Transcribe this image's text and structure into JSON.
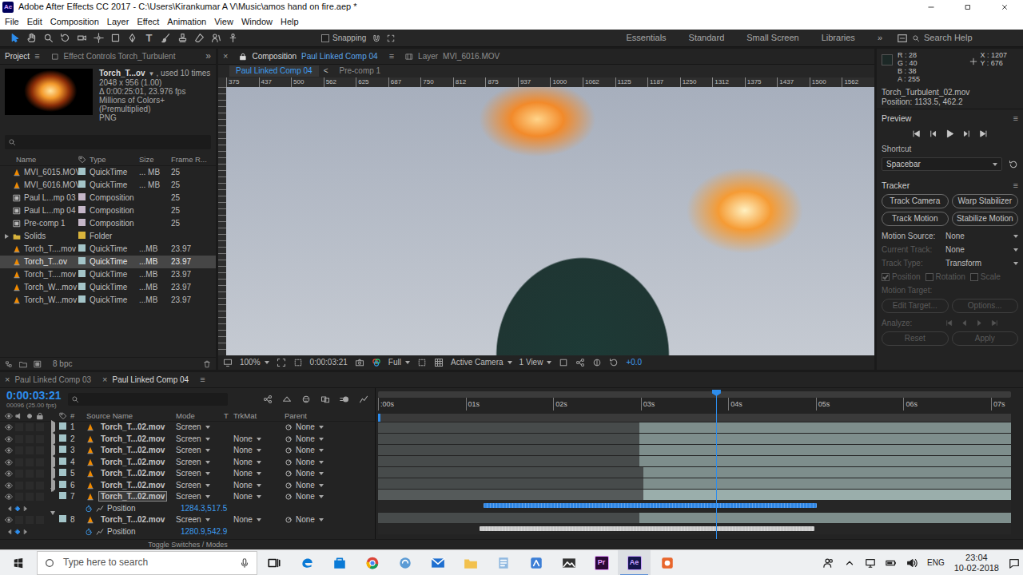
{
  "window": {
    "app_icon": "Ae",
    "title": "Adobe After Effects CC 2017 - C:\\Users\\Kirankumar A V\\Music\\amos hand on fire.aep *"
  },
  "menu": [
    "File",
    "Edit",
    "Composition",
    "Layer",
    "Effect",
    "Animation",
    "View",
    "Window",
    "Help"
  ],
  "toolbar": {
    "tools": [
      {
        "kind": "select",
        "selected": true
      },
      {
        "kind": "hand",
        "selected": false
      },
      {
        "kind": "zoom",
        "selected": false
      },
      {
        "kind": "rotate",
        "selected": false
      },
      {
        "kind": "camera",
        "selected": false
      },
      {
        "kind": "pan-behind",
        "selected": false
      },
      {
        "kind": "rectangle",
        "selected": false
      },
      {
        "kind": "pen",
        "selected": false
      },
      {
        "kind": "type",
        "label": "T",
        "selected": false
      },
      {
        "kind": "brush",
        "selected": false
      },
      {
        "kind": "stamp",
        "selected": false
      },
      {
        "kind": "eraser",
        "selected": false
      },
      {
        "kind": "roto",
        "selected": false
      },
      {
        "kind": "puppet",
        "selected": false
      }
    ],
    "snapping": {
      "label": "Snapping",
      "checked": false
    },
    "workspaces": [
      {
        "label": "Essentials",
        "selected": false
      },
      {
        "label": "Standard",
        "selected": false
      },
      {
        "label": "Small Screen",
        "selected": false
      },
      {
        "label": "Libraries",
        "selected": false
      }
    ],
    "more": "»",
    "search": "Search Help"
  },
  "project": {
    "tabs": [
      {
        "label": "Project",
        "selected": true
      },
      {
        "label": "Effect Controls Torch_Turbulent",
        "selected": false
      }
    ],
    "menu": "≡",
    "more": "»",
    "info": {
      "name": "Torch_T...ov",
      "dropdown": "▼",
      "used": ", used 10 times",
      "size": "2048 x 956 (1.00)",
      "duration": "Δ 0:00:25:01, 23.976 fps",
      "colors": "Millions of Colors+ (Premultiplied)",
      "format": "PNG"
    },
    "columns": [
      "Name",
      "Type",
      "Size",
      "Frame R..."
    ],
    "items": [
      {
        "name": "MVI_6015.MOV",
        "kind": "footage",
        "type": "QuickTime",
        "size": "... MB",
        "fps": "25",
        "color": "#a3c4c8",
        "selected": false
      },
      {
        "name": "MVI_6016.MOV",
        "kind": "footage",
        "type": "QuickTime",
        "size": "... MB",
        "fps": "25",
        "color": "#a3c4c8",
        "selected": false
      },
      {
        "name": "Paul L...mp 03",
        "kind": "composition",
        "type": "Composition",
        "fps": "25",
        "color": "#c4b6c8",
        "selected": false
      },
      {
        "name": "Paul L...mp 04",
        "kind": "composition",
        "type": "Composition",
        "fps": "25",
        "color": "#c4b6c8",
        "selected": false
      },
      {
        "name": "Pre-comp 1",
        "kind": "composition",
        "type": "Composition",
        "fps": "25",
        "color": "#c4b6c8",
        "selected": false
      },
      {
        "name": "Solids",
        "kind": "folder",
        "type": "Folder",
        "color": "#d8b33c",
        "expanded": false,
        "selected": false
      },
      {
        "name": "Torch_T....mov",
        "kind": "footage",
        "type": "QuickTime",
        "size": "...MB",
        "fps": "23.97",
        "color": "#a3c4c8",
        "selected": false
      },
      {
        "name": "Torch_T...ov",
        "kind": "footage",
        "type": "QuickTime",
        "size": "...MB",
        "fps": "23.97",
        "color": "#a3c4c8",
        "selected": true
      },
      {
        "name": "Torch_T....mov",
        "kind": "footage",
        "type": "QuickTime",
        "size": "...MB",
        "fps": "23.97",
        "color": "#a3c4c8",
        "selected": false
      },
      {
        "name": "Torch_W...mov",
        "kind": "footage",
        "type": "QuickTime",
        "size": "...MB",
        "fps": "23.97",
        "color": "#a3c4c8",
        "selected": false
      },
      {
        "name": "Torch_W...mov",
        "kind": "footage",
        "type": "QuickTime",
        "size": "...MB",
        "fps": "23.97",
        "color": "#a3c4c8",
        "selected": false
      }
    ],
    "bpc": "8 bpc"
  },
  "viewer": {
    "close": "×",
    "tabs": [
      {
        "prefix": "Composition",
        "label": "Paul Linked Comp 04",
        "kind": "composition",
        "selected": true
      },
      {
        "prefix": "Layer",
        "label": "MVI_6016.MOV",
        "kind": "layer",
        "selected": false
      }
    ],
    "menu": "≡",
    "crumbs": [
      {
        "label": "Paul Linked Comp 04",
        "selected": true
      },
      {
        "label": "Pre-comp 1",
        "selected": false
      }
    ],
    "crumb_sep": "<",
    "ruler": [
      "375",
      "437",
      "500",
      "562",
      "625",
      "687",
      "750",
      "812",
      "875",
      "937",
      "1000",
      "1062",
      "1125",
      "1187",
      "1250",
      "1312",
      "1375",
      "1437",
      "1500",
      "1562"
    ],
    "footer": {
      "zoom": "100%",
      "time": "0:00:03:21",
      "resolution": "Full",
      "camera": "Active Camera",
      "views": "1 View",
      "exposure": "+0.0"
    }
  },
  "side": {
    "info": {
      "swatch": "#1c2826",
      "lines": [
        "R : 28",
        "G : 40",
        "B : 38",
        "A : 255"
      ],
      "coords": [
        "X : 1207",
        "Y : 676"
      ],
      "layer": "Torch_Turbulent_02.mov",
      "position": "Position: 1133.5, 462.2"
    },
    "preview": {
      "title": "Preview",
      "menu": "≡",
      "controls": [
        "first",
        "prev",
        "play",
        "next",
        "last"
      ],
      "shortcut_label": "Shortcut",
      "shortcut": "Spacebar"
    },
    "tracker": {
      "title": "Tracker",
      "menu": "≡",
      "buttons": [
        "Track Camera",
        "Warp Stabilizer",
        "Track Motion",
        "Stabilize Motion"
      ],
      "fields": [
        {
          "label": "Motion Source:",
          "value": "None",
          "disabled": false
        },
        {
          "label": "Current Track:",
          "value": "None",
          "disabled": true
        },
        {
          "label": "Track Type:",
          "value": "Transform",
          "disabled": true
        }
      ],
      "checks": [
        {
          "label": "Position",
          "checked": true,
          "disabled": true
        },
        {
          "label": "Rotation",
          "checked": false,
          "disabled": true
        },
        {
          "label": "Scale",
          "checked": false,
          "disabled": true
        }
      ],
      "target_label": "Motion Target:",
      "target_disabled": true,
      "target_buttons": [
        {
          "label": "Edit Target...",
          "disabled": true
        },
        {
          "label": "Options...",
          "disabled": true
        }
      ],
      "analyze_label": "Analyze:",
      "analyze_disabled": true,
      "actions": [
        {
          "label": "Reset",
          "disabled": true
        },
        {
          "label": "Apply",
          "disabled": true
        }
      ]
    }
  },
  "timeline": {
    "tabs": [
      {
        "close": "×",
        "label": "Paul Linked Comp 03",
        "selected": false
      },
      {
        "close": "×",
        "label": "Paul Linked Comp 04",
        "selected": true
      }
    ],
    "menu": "≡",
    "time": "0:00:03:21",
    "frame": "00096 (25.00 fps)",
    "columns": [
      "#",
      "Source Name",
      "Mode",
      "T",
      "TrkMat",
      "Parent"
    ],
    "ruler": [
      ":00s",
      "01s",
      "02s",
      "03s",
      "04s",
      "05s",
      "06s",
      "07s"
    ],
    "playhead": 0.534,
    "layers": [
      {
        "num": "1",
        "name": "Torch_T...02.mov",
        "mode": "Screen",
        "trkmat": null,
        "parent": "None",
        "visible": true,
        "expanded": false,
        "selected": false,
        "start": 0.413
      },
      {
        "num": "2",
        "name": "Torch_T...02.mov",
        "mode": "Screen",
        "trkmat": "None",
        "parent": "None",
        "visible": true,
        "expanded": false,
        "selected": false,
        "start": 0.413
      },
      {
        "num": "3",
        "name": "Torch_T...02.mov",
        "mode": "Screen",
        "trkmat": "None",
        "parent": "None",
        "visible": true,
        "expanded": false,
        "selected": false,
        "start": 0.413
      },
      {
        "num": "4",
        "name": "Torch_T...02.mov",
        "mode": "Screen",
        "trkmat": "None",
        "parent": "None",
        "visible": true,
        "expanded": false,
        "selected": false,
        "start": 0.413
      },
      {
        "num": "5",
        "name": "Torch_T...02.mov",
        "mode": "Screen",
        "trkmat": "None",
        "parent": "None",
        "visible": true,
        "expanded": false,
        "selected": false,
        "start": 0.419
      },
      {
        "num": "6",
        "name": "Torch_T...02.mov",
        "mode": "Screen",
        "trkmat": "None",
        "parent": "None",
        "visible": true,
        "expanded": false,
        "selected": false,
        "start": 0.419
      },
      {
        "num": "7",
        "name": "Torch_T...02.mov",
        "mode": "Screen",
        "trkmat": "None",
        "parent": "None",
        "visible": true,
        "expanded": true,
        "selected": true,
        "start": 0.419,
        "property": {
          "label": "Position",
          "value": "1284.3,517.5",
          "from": 0.167,
          "to": 0.693,
          "color": "#2f86e4"
        }
      },
      {
        "num": "8",
        "name": "Torch_T...02.mov",
        "mode": "Screen",
        "trkmat": "None",
        "parent": "None",
        "visible": true,
        "expanded": true,
        "selected": false,
        "start": 0.413,
        "property": {
          "label": "Position",
          "value": "1280.9,542.9",
          "from": 0.16,
          "to": 0.69,
          "color": "#c9c9c9"
        }
      }
    ],
    "footer": "Toggle Switches / Modes"
  },
  "taskbar": {
    "search": "Type here to search",
    "apps": [
      {
        "kind": "task-view",
        "selected": false
      },
      {
        "kind": "edge",
        "selected": false
      },
      {
        "kind": "store",
        "selected": false
      },
      {
        "kind": "chrome",
        "selected": false
      },
      {
        "kind": "swirl",
        "selected": false
      },
      {
        "kind": "mail",
        "selected": false
      },
      {
        "kind": "explorer",
        "selected": false
      },
      {
        "kind": "notepad",
        "selected": false
      },
      {
        "kind": "blue-app",
        "selected": false
      },
      {
        "kind": "photos",
        "selected": false
      },
      {
        "kind": "premiere",
        "label": "Pr",
        "selected": false
      },
      {
        "kind": "after-effects",
        "label": "Ae",
        "selected": true
      },
      {
        "kind": "orange-app",
        "selected": false
      }
    ],
    "tray": {
      "lang": "ENG",
      "time": "23:04",
      "date": "10-02-2018"
    }
  }
}
